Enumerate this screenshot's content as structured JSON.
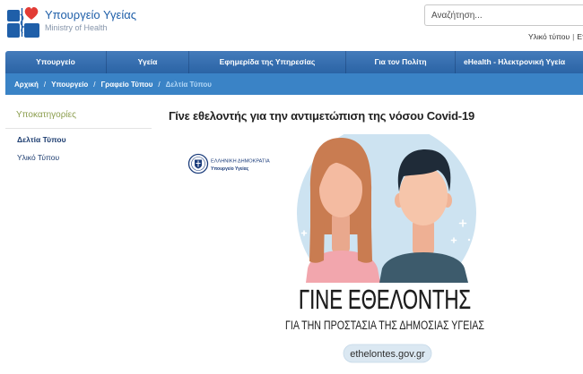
{
  "header": {
    "logo": {
      "icon": "ministry-of-health-logo-icon",
      "title": "Υπουργείο Υγείας",
      "subtitle": "Ministry of Health"
    },
    "search": {
      "placeholder": "Αναζήτηση...",
      "value": ""
    },
    "top_links": {
      "items": [
        {
          "label": "Υλικό τύπου"
        },
        {
          "label": "Ετ"
        }
      ],
      "separator": "|"
    }
  },
  "nav": {
    "items": [
      {
        "label": "Υπουργείο"
      },
      {
        "label": "Υγεία"
      },
      {
        "label": "Εφημερίδα της Υπηρεσίας"
      },
      {
        "label": "Για τον Πολίτη"
      },
      {
        "label": "eHealth - Ηλεκτρονική Υγεία"
      }
    ]
  },
  "breadcrumb": {
    "separator": "/",
    "items": [
      {
        "label": "Αρχική"
      },
      {
        "label": "Υπουργείο"
      },
      {
        "label": "Γραφείο Τύπου"
      },
      {
        "label": "Δελτία Τύπου",
        "current": true
      }
    ]
  },
  "sidebar": {
    "heading": "Υποκατηγορίες",
    "items": [
      {
        "label": "Δελτία Τύπου",
        "active": true
      },
      {
        "label": "Υλικό Τύπου",
        "active": false
      }
    ]
  },
  "article": {
    "title": "Γίνε εθελοντής για την αντιμετώπιση της νόσου Covid-19",
    "poster": {
      "emblem": {
        "icon": "greek-state-emblem-icon",
        "line1": "ΕΛΛΗΝΙΚΗ ΔΗΜΟΚΡΑΤΙΑ",
        "line2": "Υπουργείο Υγείας"
      },
      "headline": "ΓΙΝΕ ΕΘΕΛΟΝΤΗΣ",
      "subline": "ΓΙΑ ΤΗΝ ΠΡΟΣΤΑΣΙΑ ΤΗΣ ΔΗΜΟΣΙΑΣ ΥΓΕΙΑΣ",
      "url_badge": "ethelontes.gov.gr"
    }
  },
  "colors": {
    "brand_blue": "#1f5fa9",
    "nav_bg": "#2e6cb3",
    "breadcrumb_bg": "#3a83c6",
    "breadcrumb_current": "#b3d7f5",
    "sidebar_heading": "#8b9d4d",
    "link": "#1d3d70",
    "logo_heart": "#e23b35"
  }
}
